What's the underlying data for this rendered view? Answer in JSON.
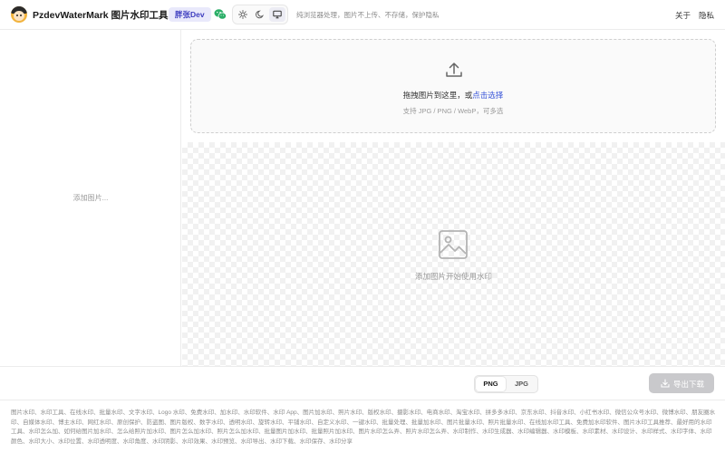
{
  "header": {
    "app_title": "PzdevWaterMark 图片水印工具",
    "badge": "胖张Dev",
    "tagline": "纯浏览器处理，图片不上传、不存储，保护隐私",
    "nav": {
      "about": "关于",
      "privacy": "隐私"
    },
    "theme_options": [
      "light",
      "dark",
      "system"
    ],
    "active_theme": "system"
  },
  "left_panel": {
    "empty_text": "添加图片..."
  },
  "upload": {
    "prompt": "拖拽图片到这里，或",
    "link": "点击选择",
    "hint": "支持 JPG / PNG / WebP，可多选"
  },
  "preview": {
    "empty_text": "添加图片开始使用水印"
  },
  "toolbar": {
    "formats": [
      "PNG",
      "JPG"
    ],
    "selected_format": "PNG",
    "export_label": "导出下载"
  },
  "footer": {
    "keywords": "图片水印、水印工具、在线水印、批量水印、文字水印、Logo 水印、免费水印、加水印、水印软件、水印 App、图片加水印、照片水印、版权水印、摄影水印、电商水印、淘宝水印、拼多多水印、京东水印、抖音水印、小红书水印、微信公众号水印、微博水印、朋友圈水印、自媒体水印、博主水印、网红水印、原创保护、防盗图、图片版权、数字水印、透明水印、旋转水印、平铺水印、自定义水印、一键水印、批量处理、批量加水印、图片批量水印、照片批量水印、在线加水印工具、免费加水印软件、图片水印工具推荐、最好用的水印工具、水印怎么加、如何给图片加水印、怎么给照片加水印、图片怎么加水印、照片怎么加水印、批量图片加水印、批量照片加水印、图片水印怎么弄、照片水印怎么弄、水印制作、水印生成器、水印编辑器、水印模板、水印素材、水印设计、水印样式、水印字体、水印颜色、水印大小、水印位置、水印透明度、水印角度、水印阴影、水印效果、水印预览、水印导出、水印下载、水印保存、水印分享"
  },
  "colors": {
    "accent": "#3b57d9",
    "badge_bg": "#e9e9fb",
    "export_disabled": "#c9c9cc",
    "wechat_green": "#2aae67"
  },
  "icons": [
    "wechat-icon",
    "sun-icon",
    "moon-icon",
    "monitor-icon",
    "upload-icon",
    "image-icon",
    "download-icon"
  ]
}
